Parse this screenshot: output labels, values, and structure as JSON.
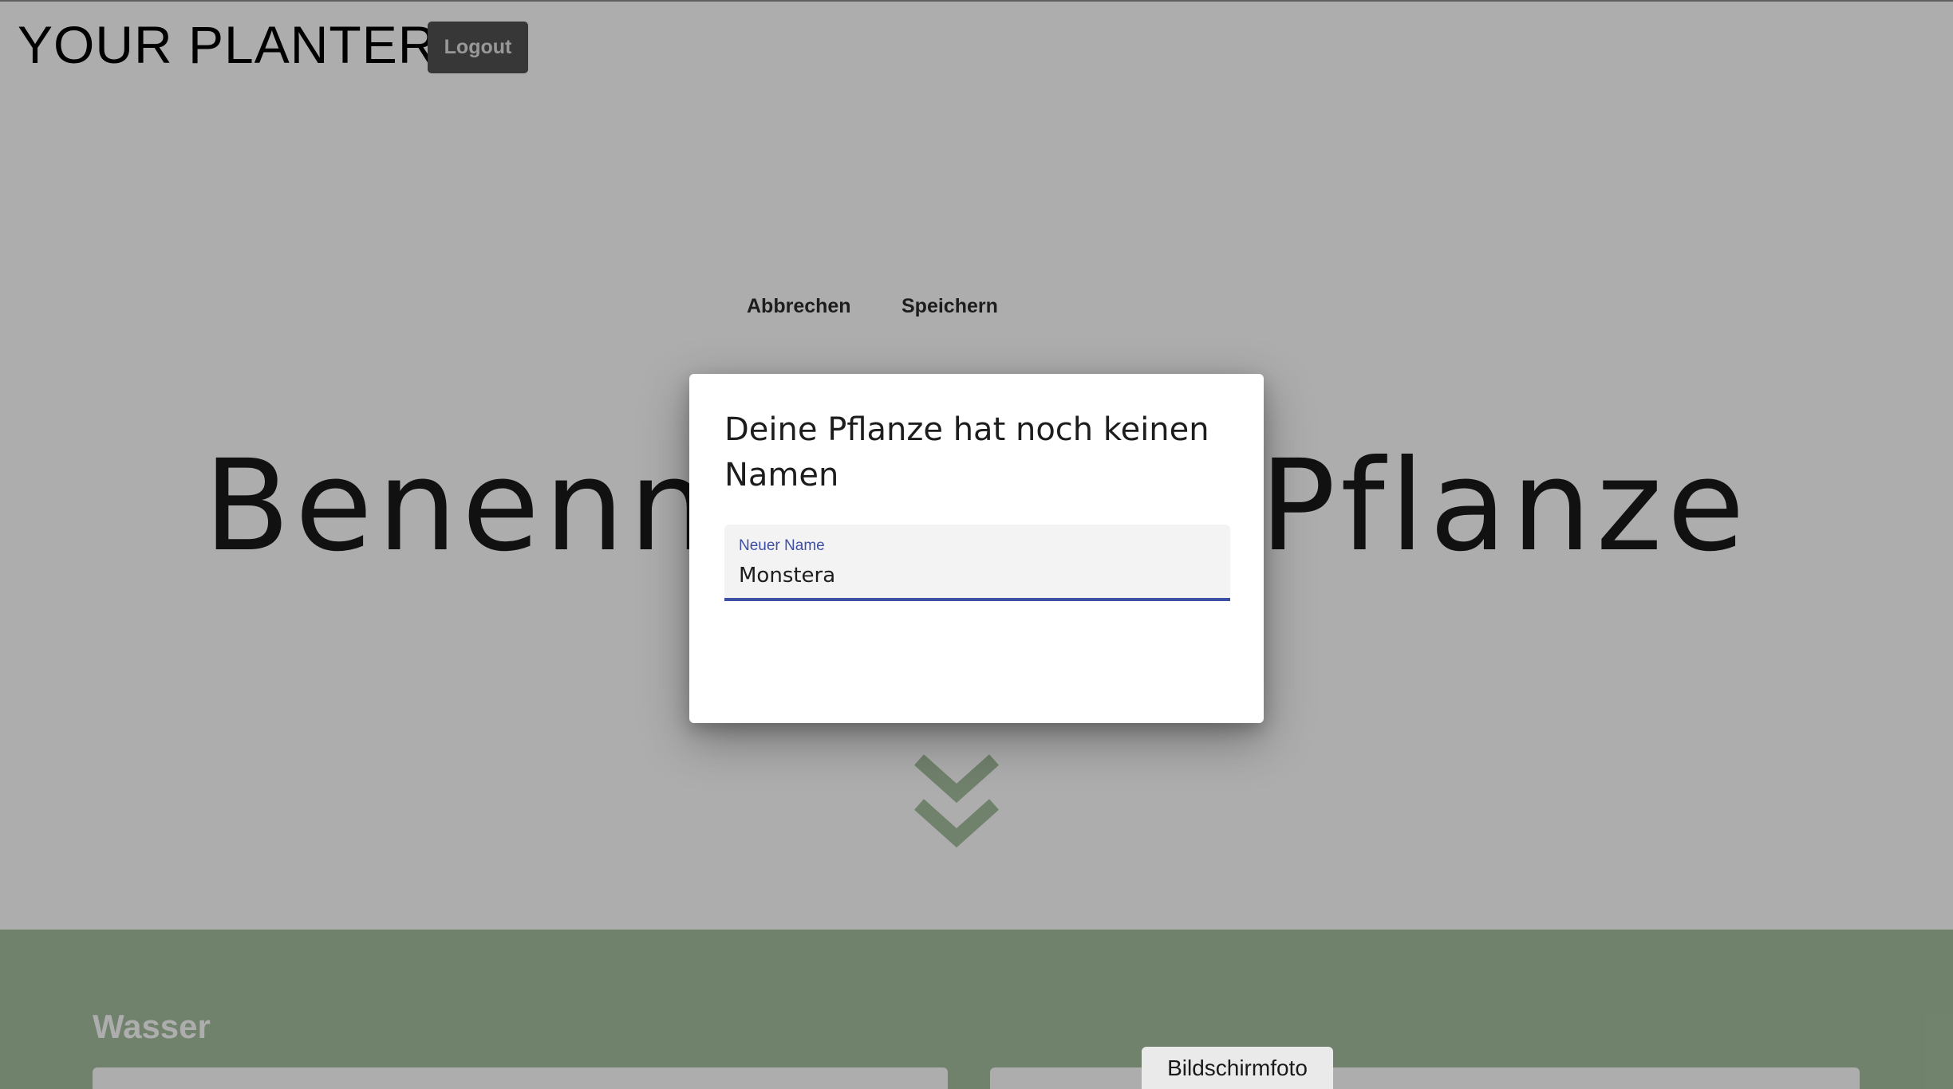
{
  "header": {
    "brand": "YOUR PLANTER",
    "logout_label": "Logout"
  },
  "hero": {
    "title": "Benenne deine Pflanze"
  },
  "icons": {
    "scroll_down": "double-chevron-down-icon"
  },
  "sections": {
    "water_title": "Wasser"
  },
  "dialog": {
    "title": "Deine Pflanze hat noch keinen Namen",
    "field_label": "Neuer Name",
    "field_value": "Monstera",
    "cancel_label": "Abbrechen",
    "save_label": "Speichern"
  },
  "tooltip": {
    "text": "Bildschirmfoto"
  },
  "colors": {
    "accent": "#3f4fa3",
    "logout_bg": "#525252",
    "section_green": "#a6bfa0",
    "chevron": "#a6bfa0"
  }
}
